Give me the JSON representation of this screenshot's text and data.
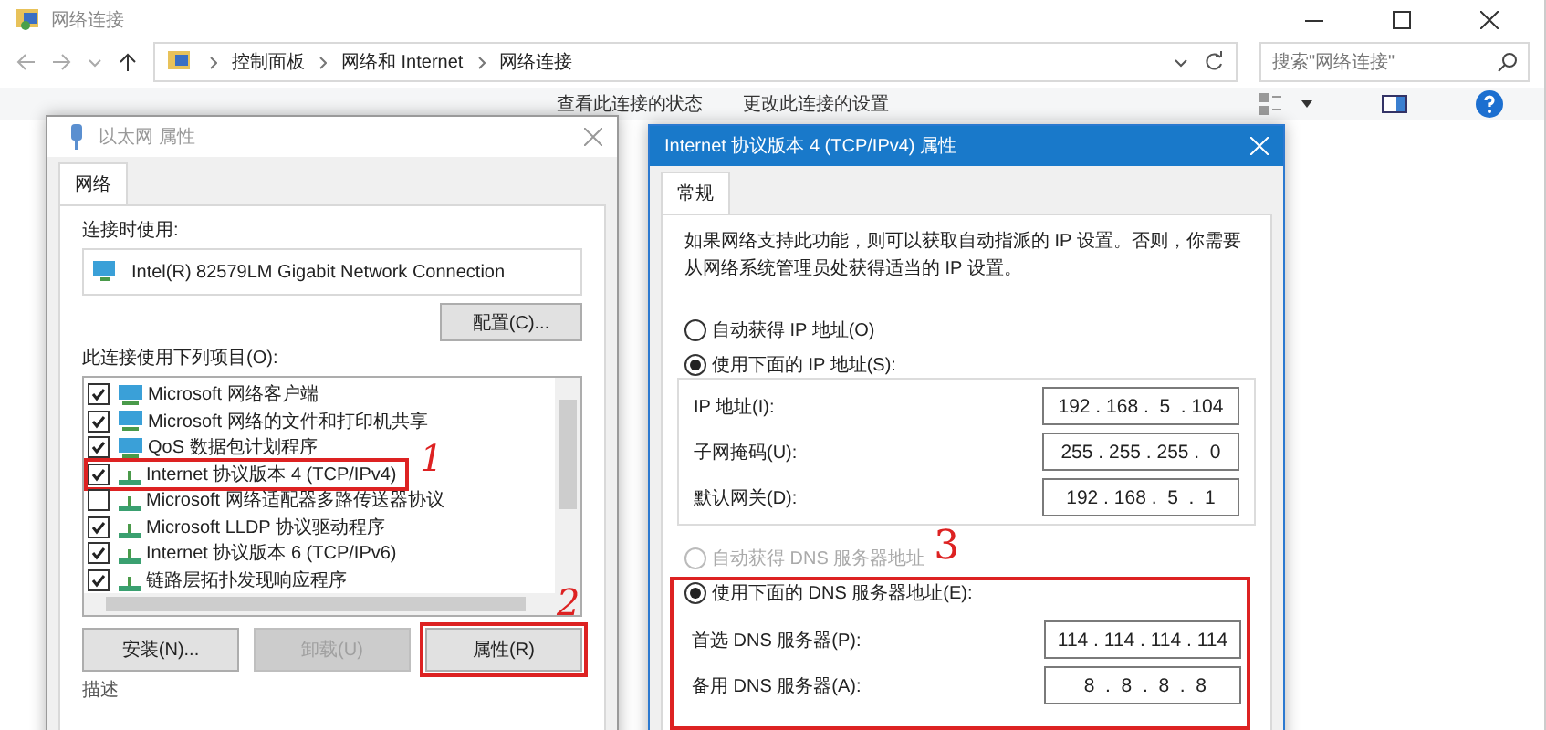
{
  "explorer": {
    "title": "网络连接",
    "breadcrumb": [
      "控制面板",
      "网络和 Internet",
      "网络连接"
    ],
    "search": {
      "placeholder": "搜索\"网络连接\""
    },
    "toolbar": [
      "查看此连接的状态",
      "更改此连接的设置"
    ]
  },
  "ethernet_dialog": {
    "title": "以太网 属性",
    "tabs": [
      {
        "label": "网络",
        "selected": true
      }
    ],
    "connect_using_label": "连接时使用:",
    "adapter": "Intel(R) 82579LM Gigabit Network Connection",
    "configure_button": "配置(C)...",
    "items_label": "此连接使用下列项目(O):",
    "items": [
      {
        "kind": "client",
        "label": "Microsoft 网络客户端",
        "checked": true
      },
      {
        "kind": "client",
        "label": "Microsoft 网络的文件和打印机共享",
        "checked": true
      },
      {
        "kind": "client",
        "label": "QoS 数据包计划程序",
        "checked": true
      },
      {
        "kind": "protocol",
        "label": "Internet 协议版本 4 (TCP/IPv4)",
        "checked": true,
        "annotation": "1"
      },
      {
        "kind": "protocol",
        "label": "Microsoft 网络适配器多路传送器协议",
        "checked": false
      },
      {
        "kind": "protocol",
        "label": "Microsoft LLDP 协议驱动程序",
        "checked": true
      },
      {
        "kind": "protocol",
        "label": "Internet 协议版本 6 (TCP/IPv6)",
        "checked": true
      },
      {
        "kind": "protocol",
        "label": "链路层拓扑发现响应程序",
        "checked": true
      }
    ],
    "buttons": [
      {
        "label": "安装(N)...",
        "disabled": false
      },
      {
        "label": "卸载(U)",
        "disabled": true
      },
      {
        "label": "属性(R)",
        "disabled": false,
        "annotation": "2"
      }
    ],
    "description_label": "描述"
  },
  "ipv4_dialog": {
    "title": "Internet 协议版本 4 (TCP/IPv4) 属性",
    "tabs": [
      {
        "label": "常规",
        "selected": true
      }
    ],
    "intro": "如果网络支持此功能，则可以获取自动指派的 IP 设置。否则，你需要从网络系统管理员处获得适当的 IP 设置。",
    "ip_options": [
      {
        "label": "自动获得 IP 地址(O)",
        "selected": false,
        "disabled": false
      },
      {
        "label": "使用下面的 IP 地址(S):",
        "selected": true,
        "disabled": false
      }
    ],
    "ip_fields": [
      {
        "label": "IP 地址(I):",
        "value": "192 . 168 .  5  . 104"
      },
      {
        "label": "子网掩码(U):",
        "value": "255 . 255 . 255 .  0"
      },
      {
        "label": "默认网关(D):",
        "value": "192 . 168 .  5  .  1"
      }
    ],
    "dns_options": [
      {
        "label": "自动获得 DNS 服务器地址",
        "selected": false,
        "disabled": true
      },
      {
        "label": "使用下面的 DNS 服务器地址(E):",
        "selected": true,
        "disabled": false
      }
    ],
    "dns_annotation": "3",
    "dns_fields": [
      {
        "label": "首选 DNS 服务器(P):",
        "value": "114 . 114 . 114 . 114"
      },
      {
        "label": "备用 DNS 服务器(A):",
        "value": " 8  .  8  .  8  .  8"
      }
    ]
  }
}
